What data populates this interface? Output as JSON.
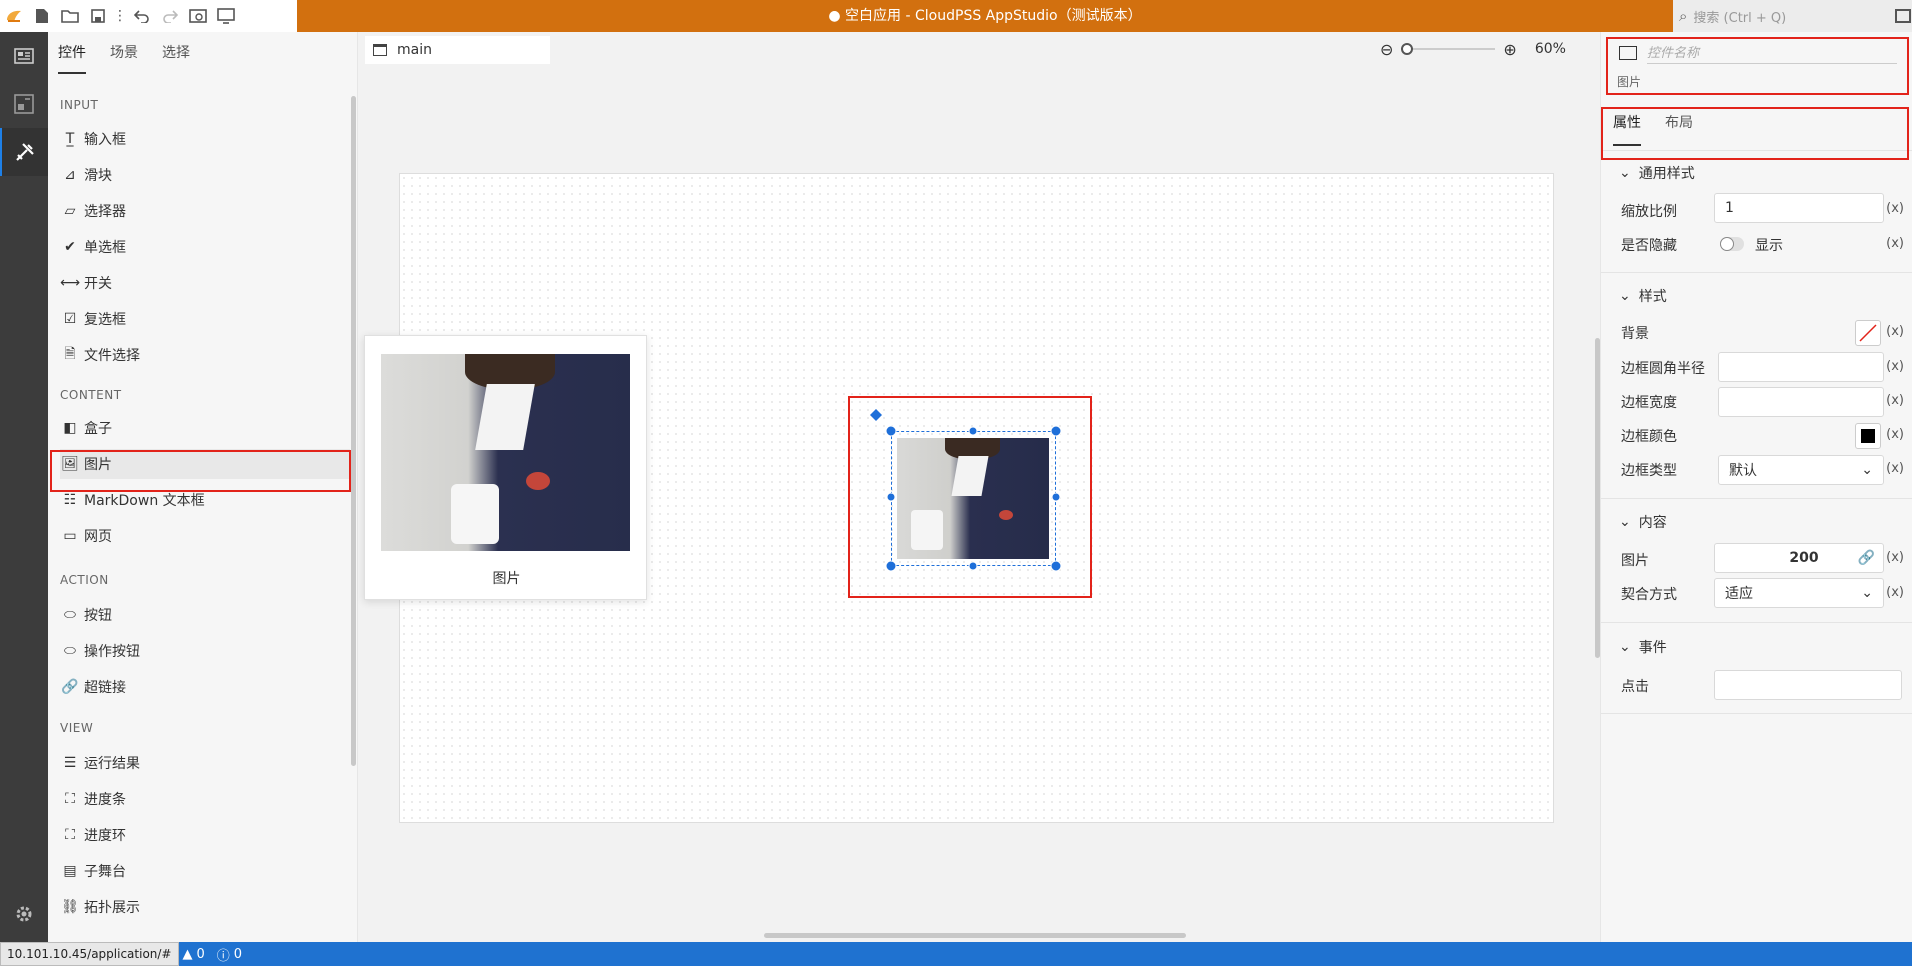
{
  "window": {
    "title": "● 空白应用 - CloudPSS AppStudio（测试版本）"
  },
  "search": {
    "placeholder": "搜索 (Ctrl + Q)"
  },
  "panel": {
    "tabs": [
      "控件",
      "场景",
      "选择"
    ],
    "sections": {
      "input": "INPUT",
      "content": "CONTENT",
      "action": "ACTION",
      "view": "VIEW"
    },
    "input_items": [
      "输入框",
      "滑块",
      "选择器",
      "单选框",
      "开关",
      "复选框",
      "文件选择"
    ],
    "content_items": [
      "盒子",
      "图片",
      "MarkDown 文本框",
      "网页"
    ],
    "action_items": [
      "按钮",
      "操作按钮",
      "超链接"
    ],
    "view_items": [
      "运行结果",
      "进度条",
      "进度环",
      "子舞台",
      "拓扑展示"
    ]
  },
  "editor": {
    "tab": "main",
    "zoom": "60%",
    "zoom_level": 0.0
  },
  "preview": {
    "caption": "图片"
  },
  "props": {
    "name_placeholder": "控件名称",
    "type": "图片",
    "tabs": [
      "属性",
      "布局"
    ],
    "group_common": "通用样式",
    "scale_label": "缩放比例",
    "scale_value": "1",
    "hidden_label": "是否隐藏",
    "hidden_value": "显示",
    "group_style": "样式",
    "bg_label": "背景",
    "radius_label": "边框圆角半径",
    "border_width_label": "边框宽度",
    "border_color_label": "边框颜色",
    "border_type_label": "边框类型",
    "border_type_value": "默认",
    "group_content": "内容",
    "image_label": "图片",
    "image_value": "200",
    "fit_label": "契合方式",
    "fit_value": "适应",
    "group_event": "事件",
    "click_label": "点击",
    "x": "(x)"
  },
  "status": {
    "url": "10.101.10.45/application/#",
    "warnings": "0",
    "infos": "0"
  },
  "colors": {
    "title_bg": "#d2700f",
    "status_bg": "#1f72d0",
    "highlight": "#e2231a",
    "selection": "#1e6fd9"
  }
}
